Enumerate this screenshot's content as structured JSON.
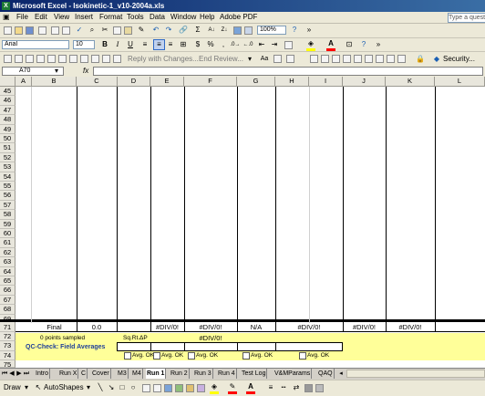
{
  "window": {
    "title": "Microsoft Excel - Isokinetic-1_v10-2004a.xls"
  },
  "menu": {
    "items": [
      "File",
      "Edit",
      "View",
      "Insert",
      "Format",
      "Tools",
      "Data",
      "Window",
      "Help",
      "Adobe PDF"
    ],
    "help_placeholder": "Type a question"
  },
  "toolbar": {
    "zoom": "100%",
    "font_name": "Arial",
    "font_size": "10",
    "bold": "B",
    "italic": "I",
    "underline": "U",
    "dollar": "$",
    "percent": "%",
    "comma": ",",
    "reply_label": "Reply with Changes...",
    "end_review_label": "End Review...",
    "security_label": "Security..."
  },
  "formula_bar": {
    "name_box": "A70",
    "fx": "fx",
    "content": ""
  },
  "grid": {
    "columns": [
      "A",
      "B",
      "C",
      "D",
      "E",
      "F",
      "G",
      "H",
      "I",
      "J",
      "K",
      "L"
    ],
    "rows": [
      "45",
      "46",
      "47",
      "48",
      "49",
      "50",
      "51",
      "52",
      "53",
      "54",
      "55",
      "56",
      "57",
      "58",
      "59",
      "60",
      "61",
      "62",
      "63",
      "64",
      "65",
      "66",
      "67",
      "68",
      "69",
      "71",
      "72",
      "73",
      "74",
      "75"
    ],
    "cells": {
      "r71_final": "Final",
      "r71_c": "0.0",
      "r71_e": "#DIV/0!",
      "r71_f": "#DIV/0!",
      "r71_g": "N/A",
      "r71_hi": "#DIV/0!",
      "r71_j": "#DIV/0!",
      "r71_k": "#DIV/0!",
      "r72_points": "0 points sampled",
      "r72_sqrt": "Sq.Rt.ΔP",
      "r72_f": "#DIV/0!",
      "r73_qc": "QC-Check: Field Averages",
      "avg_ok": "Avg. OK"
    }
  },
  "sheet_tabs": [
    "Intro",
    "Run X",
    "C",
    "Cover",
    "M3",
    "M4",
    "Run 1",
    "Run 2",
    "Run 3",
    "Run 4",
    "Test Log",
    "V&MParams",
    "QAQ"
  ],
  "active_tab": "Run 1",
  "drawing": {
    "draw_label": "Draw",
    "autoshapes_label": "AutoShapes"
  },
  "colors": {
    "title_bar": "#0a246a",
    "highlight_fill": "#ffff99",
    "font_red": "#ff0000",
    "fill_yellow": "#ffff00"
  }
}
